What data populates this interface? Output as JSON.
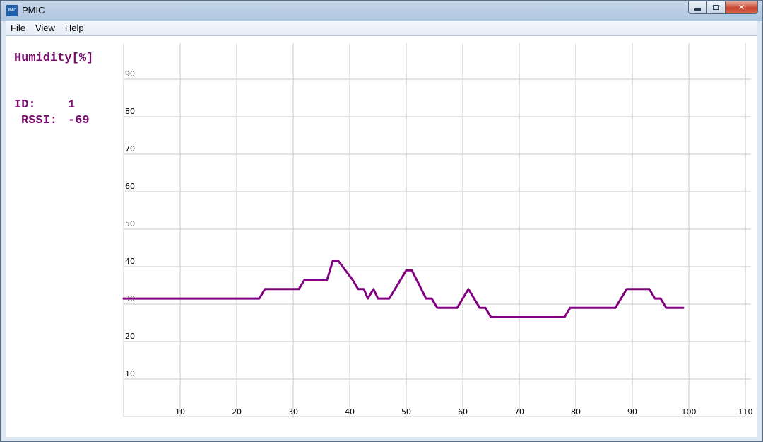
{
  "window": {
    "title": "PMIC",
    "icon_text": "PMIC",
    "controls": {
      "minimize": "minimize-icon",
      "maximize": "maximize-icon",
      "close": "close-icon"
    }
  },
  "menu": [
    "File",
    "View",
    "Help"
  ],
  "panel": {
    "title": "Humidity[%]",
    "id_label": "ID:",
    "id_value": "1",
    "rssi_label": "RSSI:",
    "rssi_value": "-69"
  },
  "colors": {
    "series": "#800080",
    "text": "#7b0a6f",
    "grid": "#c8c8c8"
  },
  "chart_data": {
    "type": "line",
    "title": "Humidity[%]",
    "xlabel": "",
    "ylabel": "",
    "xlim": [
      0,
      110
    ],
    "ylim": [
      0,
      100
    ],
    "x_ticks": [
      10,
      20,
      30,
      40,
      50,
      60,
      70,
      80,
      90,
      100,
      110
    ],
    "y_ticks": [
      10,
      20,
      30,
      40,
      50,
      60,
      70,
      80,
      90
    ],
    "grid": true,
    "series": [
      {
        "name": "",
        "color": "#800080",
        "points": [
          [
            0,
            31.5
          ],
          [
            24,
            31.5
          ],
          [
            25,
            34
          ],
          [
            31,
            34
          ],
          [
            32,
            36.5
          ],
          [
            36,
            36.5
          ],
          [
            37,
            41.5
          ],
          [
            38,
            41.5
          ],
          [
            40.5,
            36.5
          ],
          [
            41.5,
            34
          ],
          [
            42.5,
            34
          ],
          [
            43.2,
            31.5
          ],
          [
            44.2,
            34
          ],
          [
            45,
            31.5
          ],
          [
            47,
            31.5
          ],
          [
            50,
            39
          ],
          [
            51,
            39
          ],
          [
            53.5,
            31.5
          ],
          [
            54.5,
            31.5
          ],
          [
            55.5,
            29
          ],
          [
            59,
            29
          ],
          [
            61,
            34
          ],
          [
            63,
            29
          ],
          [
            64,
            29
          ],
          [
            65,
            26.5
          ],
          [
            78,
            26.5
          ],
          [
            79,
            29
          ],
          [
            87,
            29
          ],
          [
            89,
            34
          ],
          [
            93,
            34
          ],
          [
            94,
            31.5
          ],
          [
            95,
            31.5
          ],
          [
            96,
            29
          ],
          [
            99,
            29
          ]
        ]
      }
    ]
  }
}
